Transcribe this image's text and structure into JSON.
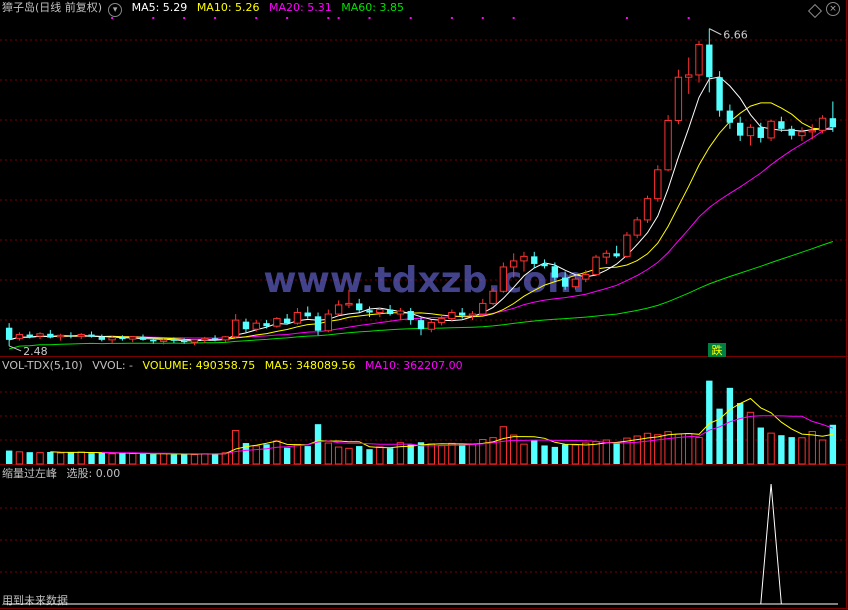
{
  "panels": {
    "price": {
      "title": "獐子岛(日线 前复权)",
      "ma": [
        {
          "label": "MA5: 5.29",
          "color": "#ffffff"
        },
        {
          "label": "MA10: 5.26",
          "color": "#ffff00"
        },
        {
          "label": "MA20: 5.31",
          "color": "#ff00ff"
        },
        {
          "label": "MA60: 3.85",
          "color": "#00e000"
        }
      ],
      "high_label": "6.66",
      "low_label": "2.48",
      "signal_label": "跌"
    },
    "volume": {
      "title": "VOL-TDX(5,10)",
      "vvol": "VVOL: -",
      "items": [
        {
          "label": "VOLUME: 490358.75",
          "color": "#ffff00"
        },
        {
          "label": "MA5: 348089.56",
          "color": "#ffff00"
        },
        {
          "label": "MA10: 362207.00",
          "color": "#ff00ff"
        }
      ]
    },
    "indicator": {
      "title": "缩量过左峰",
      "value_label": "选股: 0.00",
      "note": "用到未来数据"
    }
  },
  "watermark": "www.tdxzb.com",
  "colors": {
    "up": "#ff3232",
    "down": "#54ffff",
    "grid": "#7a0000",
    "ma5": "#ffffff",
    "ma10": "#ffff00",
    "ma20": "#ff00ff",
    "ma60": "#00e000",
    "title": "#c0c0c0"
  },
  "chart_data": {
    "type": "candlestick",
    "ohlc": [
      [
        2.72,
        2.78,
        2.48,
        2.56
      ],
      [
        2.58,
        2.66,
        2.55,
        2.63
      ],
      [
        2.63,
        2.67,
        2.58,
        2.6
      ],
      [
        2.61,
        2.66,
        2.57,
        2.64
      ],
      [
        2.64,
        2.69,
        2.58,
        2.59
      ],
      [
        2.6,
        2.64,
        2.55,
        2.62
      ],
      [
        2.62,
        2.66,
        2.58,
        2.61
      ],
      [
        2.61,
        2.65,
        2.57,
        2.63
      ],
      [
        2.63,
        2.67,
        2.59,
        2.6
      ],
      [
        2.6,
        2.63,
        2.54,
        2.56
      ],
      [
        2.56,
        2.61,
        2.52,
        2.59
      ],
      [
        2.59,
        2.62,
        2.55,
        2.57
      ],
      [
        2.57,
        2.61,
        2.53,
        2.6
      ],
      [
        2.6,
        2.63,
        2.55,
        2.56
      ],
      [
        2.56,
        2.59,
        2.51,
        2.54
      ],
      [
        2.54,
        2.58,
        2.5,
        2.56
      ],
      [
        2.56,
        2.59,
        2.52,
        2.55
      ],
      [
        2.55,
        2.58,
        2.51,
        2.53
      ],
      [
        2.53,
        2.57,
        2.49,
        2.56
      ],
      [
        2.56,
        2.6,
        2.52,
        2.58
      ],
      [
        2.58,
        2.62,
        2.54,
        2.56
      ],
      [
        2.56,
        2.61,
        2.53,
        2.6
      ],
      [
        2.6,
        2.9,
        2.58,
        2.82
      ],
      [
        2.8,
        2.84,
        2.66,
        2.7
      ],
      [
        2.7,
        2.82,
        2.67,
        2.78
      ],
      [
        2.78,
        2.82,
        2.71,
        2.74
      ],
      [
        2.74,
        2.86,
        2.72,
        2.84
      ],
      [
        2.84,
        2.9,
        2.76,
        2.78
      ],
      [
        2.78,
        2.98,
        2.76,
        2.92
      ],
      [
        2.92,
        3.0,
        2.84,
        2.87
      ],
      [
        2.87,
        2.92,
        2.62,
        2.68
      ],
      [
        2.68,
        2.96,
        2.66,
        2.9
      ],
      [
        2.9,
        3.08,
        2.88,
        3.02
      ],
      [
        3.02,
        3.22,
        2.98,
        3.04
      ],
      [
        3.04,
        3.1,
        2.92,
        2.95
      ],
      [
        2.95,
        3.0,
        2.86,
        2.92
      ],
      [
        2.92,
        2.98,
        2.86,
        2.96
      ],
      [
        2.96,
        3.02,
        2.88,
        2.9
      ],
      [
        2.9,
        2.98,
        2.82,
        2.94
      ],
      [
        2.94,
        2.98,
        2.76,
        2.82
      ],
      [
        2.82,
        2.86,
        2.62,
        2.7
      ],
      [
        2.7,
        2.82,
        2.66,
        2.79
      ],
      [
        2.79,
        2.9,
        2.75,
        2.84
      ],
      [
        2.84,
        2.96,
        2.8,
        2.92
      ],
      [
        2.92,
        2.98,
        2.84,
        2.88
      ],
      [
        2.88,
        2.94,
        2.82,
        2.9
      ],
      [
        2.9,
        3.1,
        2.88,
        3.04
      ],
      [
        3.04,
        3.24,
        3.02,
        3.2
      ],
      [
        3.2,
        3.58,
        3.18,
        3.52
      ],
      [
        3.52,
        3.7,
        3.38,
        3.6
      ],
      [
        3.6,
        3.72,
        3.46,
        3.66
      ],
      [
        3.66,
        3.72,
        3.5,
        3.56
      ],
      [
        3.56,
        3.62,
        3.5,
        3.53
      ],
      [
        3.53,
        3.58,
        3.34,
        3.38
      ],
      [
        3.38,
        3.46,
        3.22,
        3.26
      ],
      [
        3.26,
        3.4,
        3.22,
        3.36
      ],
      [
        3.36,
        3.48,
        3.32,
        3.42
      ],
      [
        3.42,
        3.68,
        3.4,
        3.65
      ],
      [
        3.65,
        3.74,
        3.56,
        3.7
      ],
      [
        3.7,
        3.8,
        3.64,
        3.66
      ],
      [
        3.66,
        3.98,
        3.64,
        3.94
      ],
      [
        3.94,
        4.18,
        3.9,
        4.14
      ],
      [
        4.14,
        4.46,
        4.1,
        4.42
      ],
      [
        4.42,
        4.86,
        4.38,
        4.8
      ],
      [
        4.8,
        5.52,
        4.78,
        5.45
      ],
      [
        5.45,
        6.12,
        5.4,
        6.02
      ],
      [
        6.02,
        6.28,
        5.8,
        6.05
      ],
      [
        6.05,
        6.5,
        5.95,
        6.45
      ],
      [
        6.45,
        6.66,
        5.82,
        6.02
      ],
      [
        6.02,
        6.1,
        5.5,
        5.58
      ],
      [
        5.58,
        5.66,
        5.34,
        5.42
      ],
      [
        5.42,
        5.5,
        5.18,
        5.25
      ],
      [
        5.25,
        5.4,
        5.12,
        5.36
      ],
      [
        5.36,
        5.42,
        5.16,
        5.22
      ],
      [
        5.22,
        5.46,
        5.18,
        5.44
      ],
      [
        5.44,
        5.5,
        5.3,
        5.34
      ],
      [
        5.34,
        5.38,
        5.2,
        5.25
      ],
      [
        5.25,
        5.36,
        5.18,
        5.3
      ],
      [
        5.3,
        5.4,
        5.2,
        5.32
      ],
      [
        5.32,
        5.52,
        5.28,
        5.48
      ],
      [
        5.48,
        5.7,
        5.3,
        5.36
      ]
    ],
    "volume": [
      168000,
      152000,
      148000,
      142000,
      150000,
      138000,
      146000,
      150000,
      136000,
      140000,
      128000,
      134000,
      131000,
      127000,
      124000,
      130000,
      121000,
      126000,
      118000,
      128000,
      132000,
      140000,
      418000,
      262000,
      226000,
      246000,
      288000,
      204000,
      244000,
      224000,
      498000,
      262000,
      212000,
      196000,
      224000,
      185000,
      214000,
      198000,
      266000,
      242000,
      272000,
      252000,
      232000,
      258000,
      242000,
      248000,
      306000,
      330000,
      466000,
      362000,
      248000,
      298000,
      232000,
      214000,
      244000,
      238000,
      262000,
      280000,
      300000,
      268000,
      324000,
      350000,
      384000,
      366000,
      404000,
      374000,
      380000,
      332000,
      1042000,
      692000,
      952000,
      762000,
      646000,
      456000,
      386000,
      360000,
      336000,
      328000,
      406000,
      300000,
      490358.75
    ],
    "mv": {
      "VOLUME": 490358.75,
      "MA5": 348089.56,
      "MA10": 362207.0
    },
    "ma_values": {
      "MA5": 5.29,
      "MA10": 5.26,
      "MA20": 5.31,
      "MA60": 3.85
    },
    "price_max_label": 6.66,
    "price_min_label": 2.48,
    "indicator": {
      "name": "缩量过左峰",
      "signal_index": 74,
      "value": 0.0
    }
  }
}
